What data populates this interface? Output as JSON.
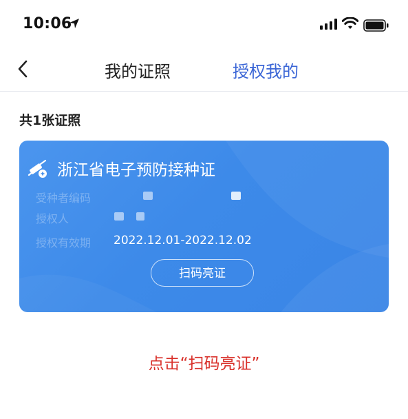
{
  "status_bar": {
    "time": "10:06",
    "icons": [
      "location-arrow-icon",
      "signal-icon",
      "wifi-icon",
      "battery-icon"
    ]
  },
  "nav": {
    "back_icon": "chevron-left-icon",
    "tabs": [
      {
        "label": "我的证照",
        "active": false
      },
      {
        "label": "授权我的",
        "active": true
      }
    ],
    "active_color": "#3b66d6"
  },
  "summary": {
    "count_label": "共1张证照"
  },
  "card": {
    "icon": "syringe-icon",
    "title": "浙江省电子预防接种证",
    "fields": [
      {
        "label": "受种者编码"
      },
      {
        "label": "授权人"
      },
      {
        "label": "授权有效期",
        "value": "2022.12.01-2022.12.02"
      }
    ],
    "button_label": "扫码亮证",
    "background_color": "#3d8ae9"
  },
  "hint": {
    "text": "点击“扫码亮证”",
    "color": "#d9312b"
  }
}
